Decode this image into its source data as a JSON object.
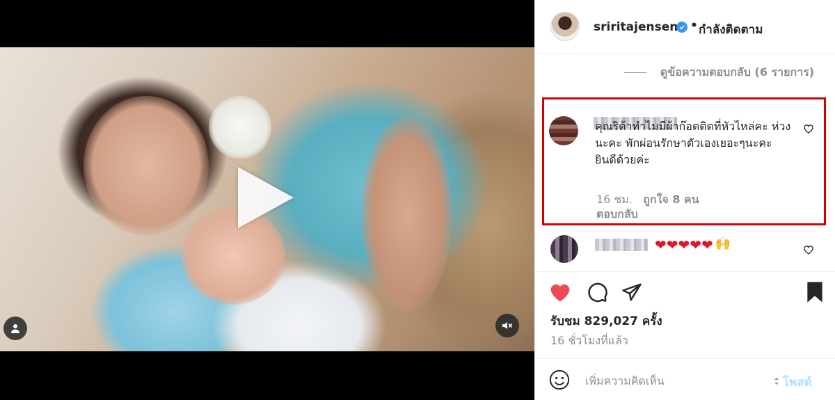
{
  "post": {
    "username": "sriritajensen",
    "separator": "•",
    "follow_status": "กำลังติดตาม"
  },
  "replies": {
    "view_label": "ดูข้อความตอบกลับ (6 รายการ)"
  },
  "highlighted_comment": {
    "text": "คุณริต้าทำไมมีผ้าก๊อตติดที่หัวไหล่คะ ห่วงนะคะ พักผ่อนรักษาตัวเองเยอะๆนะคะ ยินดีด้วยค่ะ",
    "time": "16 ชม.",
    "likes": "ถูกใจ 8 คน",
    "reply_label": "ตอบกลับ"
  },
  "second_comment": {
    "emoji_text": "❤❤❤❤❤",
    "hands_emoji": "🙌"
  },
  "stats": {
    "views": "รับชม 829,027 ครั้ง",
    "time_ago": "16 ชั่วโมงที่แล้ว"
  },
  "composer": {
    "placeholder": "เพิ่มความคิดเห็น",
    "post_label": "โพสต์"
  },
  "colors": {
    "like_red": "#ed4956",
    "highlight_red": "#d70000",
    "verified_blue": "#3897f0",
    "post_blue_disabled": "#b2dffc"
  },
  "icons": {
    "like": "heart-icon",
    "comment": "comment-icon",
    "share": "paper-plane-icon",
    "save": "bookmark-icon",
    "emoji": "smiley-icon",
    "mute": "speaker-muted-icon",
    "user_tag": "person-icon",
    "play": "play-icon"
  }
}
